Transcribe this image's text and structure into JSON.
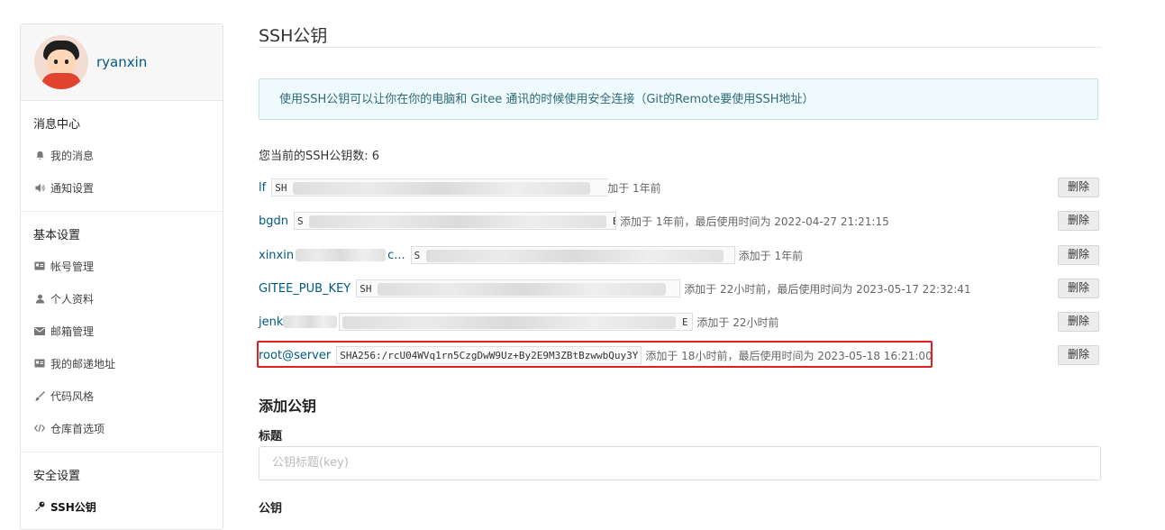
{
  "sidebar": {
    "username": "ryanxin",
    "sections": [
      {
        "title": "消息中心",
        "items": [
          {
            "label": "我的消息",
            "icon": "bell-icon"
          },
          {
            "label": "通知设置",
            "icon": "volume-icon"
          }
        ]
      },
      {
        "title": "基本设置",
        "items": [
          {
            "label": "帐号管理",
            "icon": "id-card-icon"
          },
          {
            "label": "个人资料",
            "icon": "user-icon"
          },
          {
            "label": "邮箱管理",
            "icon": "mail-icon"
          },
          {
            "label": "我的邮递地址",
            "icon": "address-card-icon"
          },
          {
            "label": "代码风格",
            "icon": "brush-icon"
          },
          {
            "label": "仓库首选项",
            "icon": "code-icon"
          }
        ]
      },
      {
        "title": "安全设置",
        "items": [
          {
            "label": "SSH公钥",
            "icon": "key-icon",
            "active": true
          }
        ]
      }
    ]
  },
  "main": {
    "title": "SSH公钥",
    "info": "使用SSH公钥可以让你在你的电脑和 Gitee 通讯的时候使用安全连接（Git的Remote要使用SSH地址）",
    "count_text": "您当前的SSH公钥数: 6",
    "keys": [
      {
        "name": "lf",
        "fp": "SH",
        "meta": "加于 1年前"
      },
      {
        "name": "bgdn",
        "fp": "S",
        "fp_end": "E",
        "meta": "添加于 1年前，最后使用时间为 2022-04-27 21:21:15"
      },
      {
        "name": "xinxin",
        "name_tail": "c...",
        "fp": "S",
        "meta": "添加于 1年前"
      },
      {
        "name": "GITEE_PUB_KEY",
        "fp": "SH",
        "meta": "添加于 22小时前，最后使用时间为 2023-05-17 22:32:41"
      },
      {
        "name": "jenk",
        "fp_end": "E",
        "meta": "添加于 22小时前"
      },
      {
        "name": "root@server",
        "fp": "SHA256:/rcU04WVq1rn5CzgDwW9Uz+By2E9M3ZBtBzwwbQuy3Y",
        "meta": "添加于 18小时前，最后使用时间为 2023-05-18 16:21:00"
      }
    ],
    "delete_label": "删除",
    "add_title": "添加公钥",
    "title_label": "标题",
    "title_placeholder": "公钥标题(key)",
    "key_label": "公钥"
  }
}
